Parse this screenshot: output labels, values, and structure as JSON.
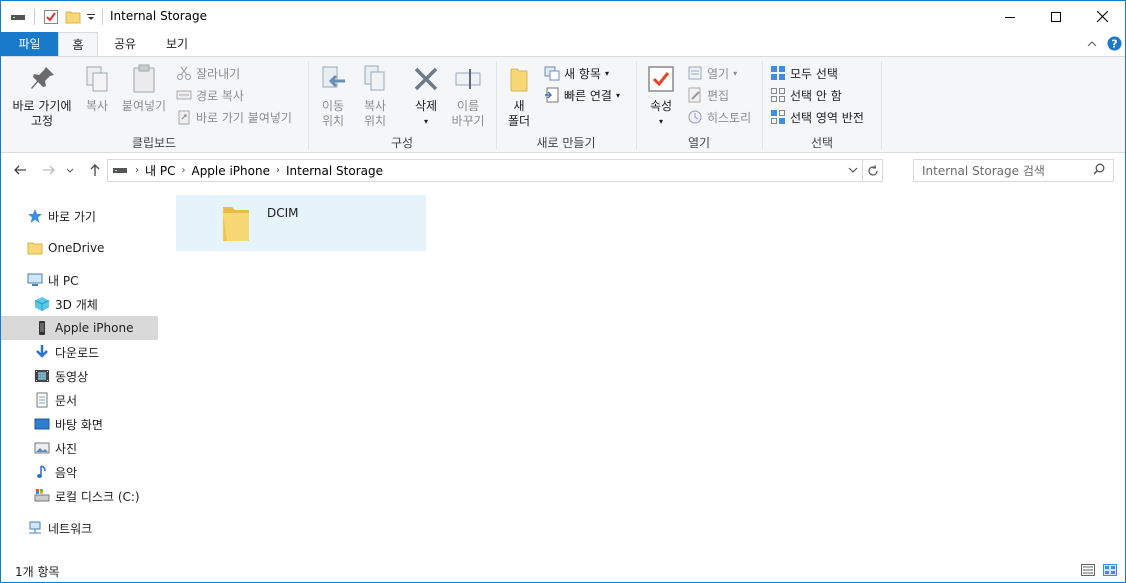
{
  "window": {
    "title": "Internal Storage"
  },
  "ribbon_tabs": [
    "파일",
    "홈",
    "공유",
    "보기"
  ],
  "ribbon": {
    "clipboard": {
      "pin": "바로 가기에\n고정",
      "copy": "복사",
      "paste": "붙여넣기",
      "cut": "잘라내기",
      "copy_path": "경로 복사",
      "paste_shortcut": "바로 가기 붙여넣기",
      "label": "클립보드"
    },
    "organize": {
      "move_to": "이동\n위치",
      "copy_to": "복사\n위치",
      "delete": "삭제",
      "rename": "이름\n바꾸기",
      "label": "구성"
    },
    "new": {
      "new_folder": "새\n폴더",
      "new_item": "새 항목",
      "easy_access": "빠른 연결",
      "label": "새로 만들기"
    },
    "open": {
      "properties": "속성",
      "open": "열기",
      "edit": "편집",
      "history": "히스토리",
      "label": "열기"
    },
    "select": {
      "select_all": "모두 선택",
      "select_none": "선택 안 함",
      "invert": "선택 영역 반전",
      "label": "선택"
    }
  },
  "address": {
    "crumbs": [
      "내 PC",
      "Apple iPhone",
      "Internal Storage"
    ],
    "search_placeholder": "Internal Storage 검색"
  },
  "nav": {
    "items": [
      {
        "label": "바로 가기",
        "icon": "star-icon"
      },
      {
        "label": "OneDrive",
        "icon": "folder-icon"
      },
      {
        "label": "내 PC",
        "icon": "computer-icon"
      },
      {
        "label": "3D 개체",
        "icon": "cube-icon"
      },
      {
        "label": "Apple iPhone",
        "icon": "phone-icon"
      },
      {
        "label": "다운로드",
        "icon": "download-icon"
      },
      {
        "label": "동영상",
        "icon": "video-icon"
      },
      {
        "label": "문서",
        "icon": "document-icon"
      },
      {
        "label": "바탕 화면",
        "icon": "desktop-icon"
      },
      {
        "label": "사진",
        "icon": "picture-icon"
      },
      {
        "label": "음악",
        "icon": "music-icon"
      },
      {
        "label": "로컬 디스크 (C:)",
        "icon": "drive-icon"
      },
      {
        "label": "네트워크",
        "icon": "network-icon"
      }
    ],
    "selected": "Apple iPhone"
  },
  "content": {
    "items": [
      {
        "name": "DCIM",
        "type": "folder"
      }
    ]
  },
  "status": {
    "count": "1개 항목"
  },
  "colors": {
    "accent": "#1979ca",
    "selection": "#e5f3fb",
    "nav_selected": "#d9d9d9"
  }
}
